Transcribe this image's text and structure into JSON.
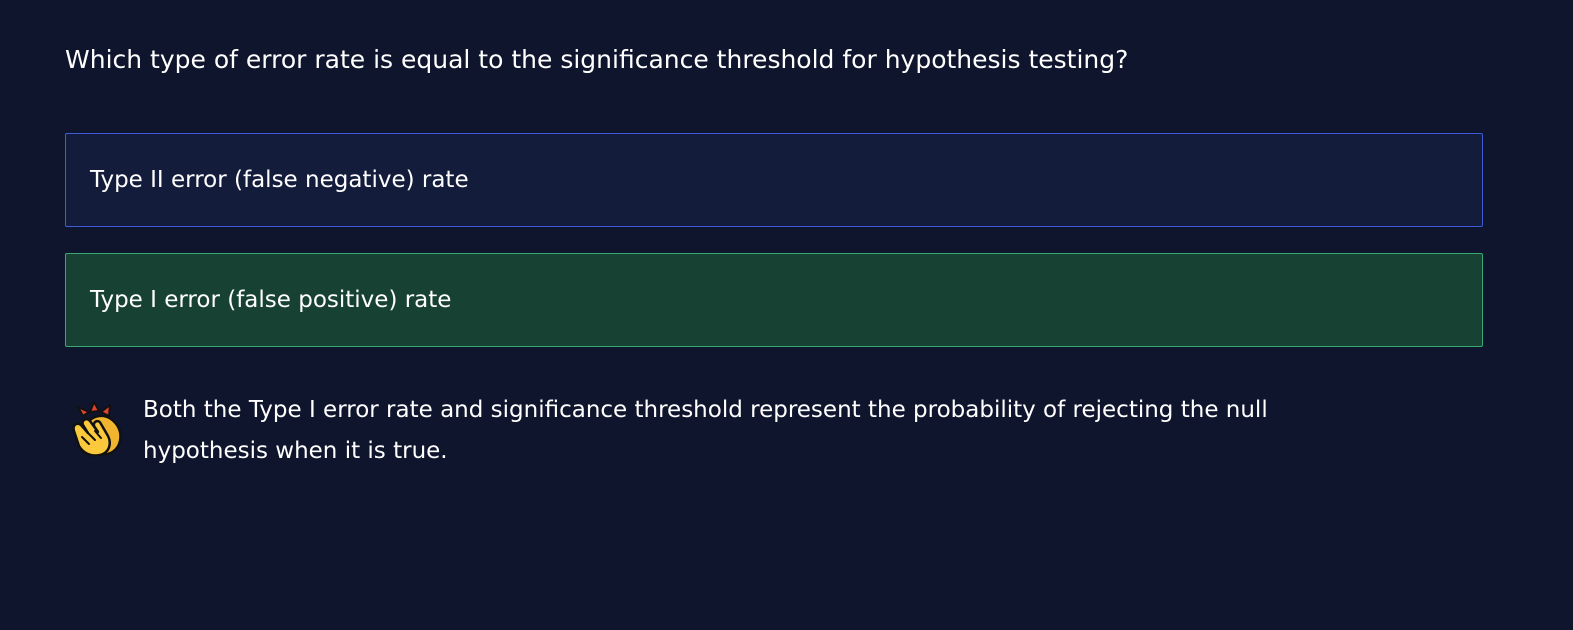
{
  "question": {
    "text": "Which type of error rate is equal to the significance threshold for hypothesis testing?"
  },
  "options": [
    {
      "label": "Type II error (false negative) rate",
      "state": "unselected"
    },
    {
      "label": "Type I error (false positive) rate",
      "state": "correct"
    }
  ],
  "feedback": {
    "icon": "clapping-hands-icon",
    "text": "Both the Type I error rate and significance threshold represent the probability of rejecting the null hypothesis when it is true."
  },
  "colors": {
    "background": "#10152e",
    "option_default_bg": "#141c3c",
    "option_default_border": "#3e5bd8",
    "option_correct_bg": "#174233",
    "option_correct_border": "#3aa872",
    "text": "#ffffff"
  }
}
